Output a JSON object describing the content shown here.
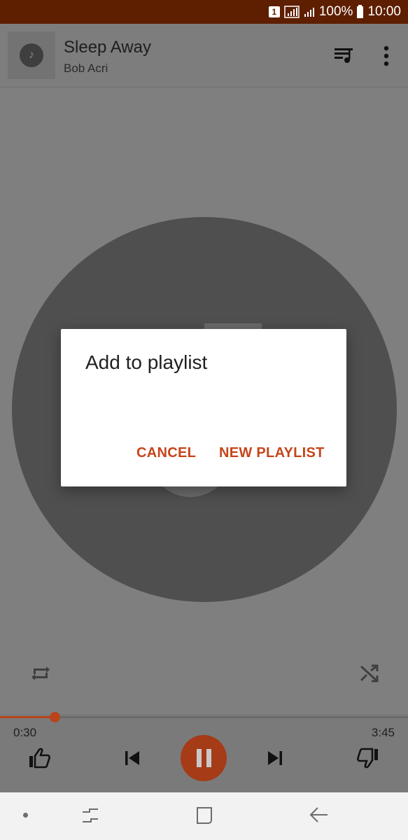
{
  "status_bar": {
    "sim": "1",
    "battery": "100%",
    "time": "10:00"
  },
  "now_playing": {
    "title": "Sleep Away",
    "artist": "Bob Acri"
  },
  "player": {
    "current_time": "0:30",
    "total_time": "3:45",
    "progress": 0.133
  },
  "dialog": {
    "title": "Add to playlist",
    "cancel_label": "CANCEL",
    "new_playlist_label": "NEW PLAYLIST"
  },
  "colors": {
    "accent": "#c6451a",
    "status_bar": "#5e1e00"
  },
  "icons": {
    "top_bar": [
      "music-note-icon",
      "queue-music-icon",
      "more-vert-icon"
    ],
    "controls": [
      "repeat-icon",
      "shuffle-icon",
      "thumb-up-icon",
      "skip-previous-icon",
      "pause-icon",
      "skip-next-icon",
      "thumb-down-icon"
    ],
    "nav": [
      "nav-dot-icon",
      "recents-icon",
      "home-icon",
      "back-icon"
    ]
  }
}
